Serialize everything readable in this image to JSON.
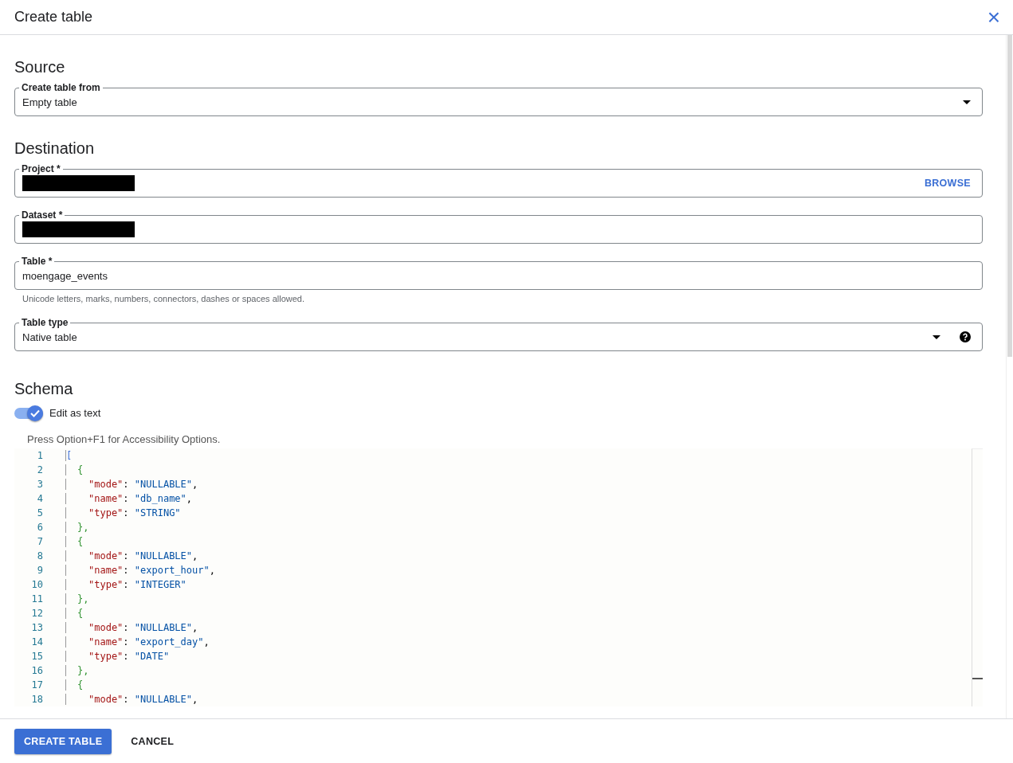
{
  "dialog": {
    "title": "Create table",
    "close_icon": "×"
  },
  "source": {
    "heading": "Source",
    "field": {
      "label": "Create table from",
      "value": "Empty table"
    }
  },
  "destination": {
    "heading": "Destination",
    "fields": [
      {
        "kind": "browse",
        "label": "Project *",
        "redacted": true,
        "action": "BROWSE"
      },
      {
        "kind": "text",
        "label": "Dataset *",
        "redacted": true
      },
      {
        "kind": "text",
        "label": "Table *",
        "value": "moengage_events",
        "helper": "Unicode letters, marks, numbers, connectors, dashes or spaces allowed."
      },
      {
        "kind": "select-help",
        "label": "Table type",
        "value": "Native table"
      }
    ]
  },
  "schema": {
    "heading": "Schema",
    "toggle": {
      "label": "Edit as text",
      "on": true
    },
    "editor_hint": "Press Option+F1 for Accessibility Options.",
    "code_lines": [
      {
        "number": "1",
        "kind": "array-open",
        "text": "["
      },
      {
        "number": "2",
        "kind": "object-open",
        "text": "{"
      },
      {
        "number": "3",
        "kind": "property",
        "key": "\"mode\"",
        "sep": ":",
        "value": "\"NULLABLE\"",
        "trail": ","
      },
      {
        "number": "4",
        "kind": "property",
        "key": "\"name\"",
        "sep": ":",
        "value": "\"db_name\"",
        "trail": ","
      },
      {
        "number": "5",
        "kind": "property",
        "key": "\"type\"",
        "sep": ":",
        "value": "\"STRING\""
      },
      {
        "number": "6",
        "kind": "object-close",
        "text": "},"
      },
      {
        "number": "7",
        "kind": "object-open",
        "text": "{"
      },
      {
        "number": "8",
        "kind": "property",
        "key": "\"mode\"",
        "sep": ":",
        "value": "\"NULLABLE\"",
        "trail": ","
      },
      {
        "number": "9",
        "kind": "property",
        "key": "\"name\"",
        "sep": ":",
        "value": "\"export_hour\"",
        "trail": ","
      },
      {
        "number": "10",
        "kind": "property",
        "key": "\"type\"",
        "sep": ":",
        "value": "\"INTEGER\""
      },
      {
        "number": "11",
        "kind": "object-close",
        "text": "},"
      },
      {
        "number": "12",
        "kind": "object-open",
        "text": "{"
      },
      {
        "number": "13",
        "kind": "property",
        "key": "\"mode\"",
        "sep": ":",
        "value": "\"NULLABLE\"",
        "trail": ","
      },
      {
        "number": "14",
        "kind": "property",
        "key": "\"name\"",
        "sep": ":",
        "value": "\"export_day\"",
        "trail": ","
      },
      {
        "number": "15",
        "kind": "property",
        "key": "\"type\"",
        "sep": ":",
        "value": "\"DATE\""
      },
      {
        "number": "16",
        "kind": "object-close",
        "text": "},"
      },
      {
        "number": "17",
        "kind": "object-open",
        "text": "{"
      },
      {
        "number": "18",
        "kind": "property",
        "key": "\"mode\"",
        "sep": ":",
        "value": "\"NULLABLE\"",
        "trail": ","
      }
    ]
  },
  "footer": {
    "buttons": [
      {
        "label": "CREATE TABLE",
        "kind": "primary"
      },
      {
        "label": "CANCEL",
        "kind": "text"
      }
    ]
  }
}
